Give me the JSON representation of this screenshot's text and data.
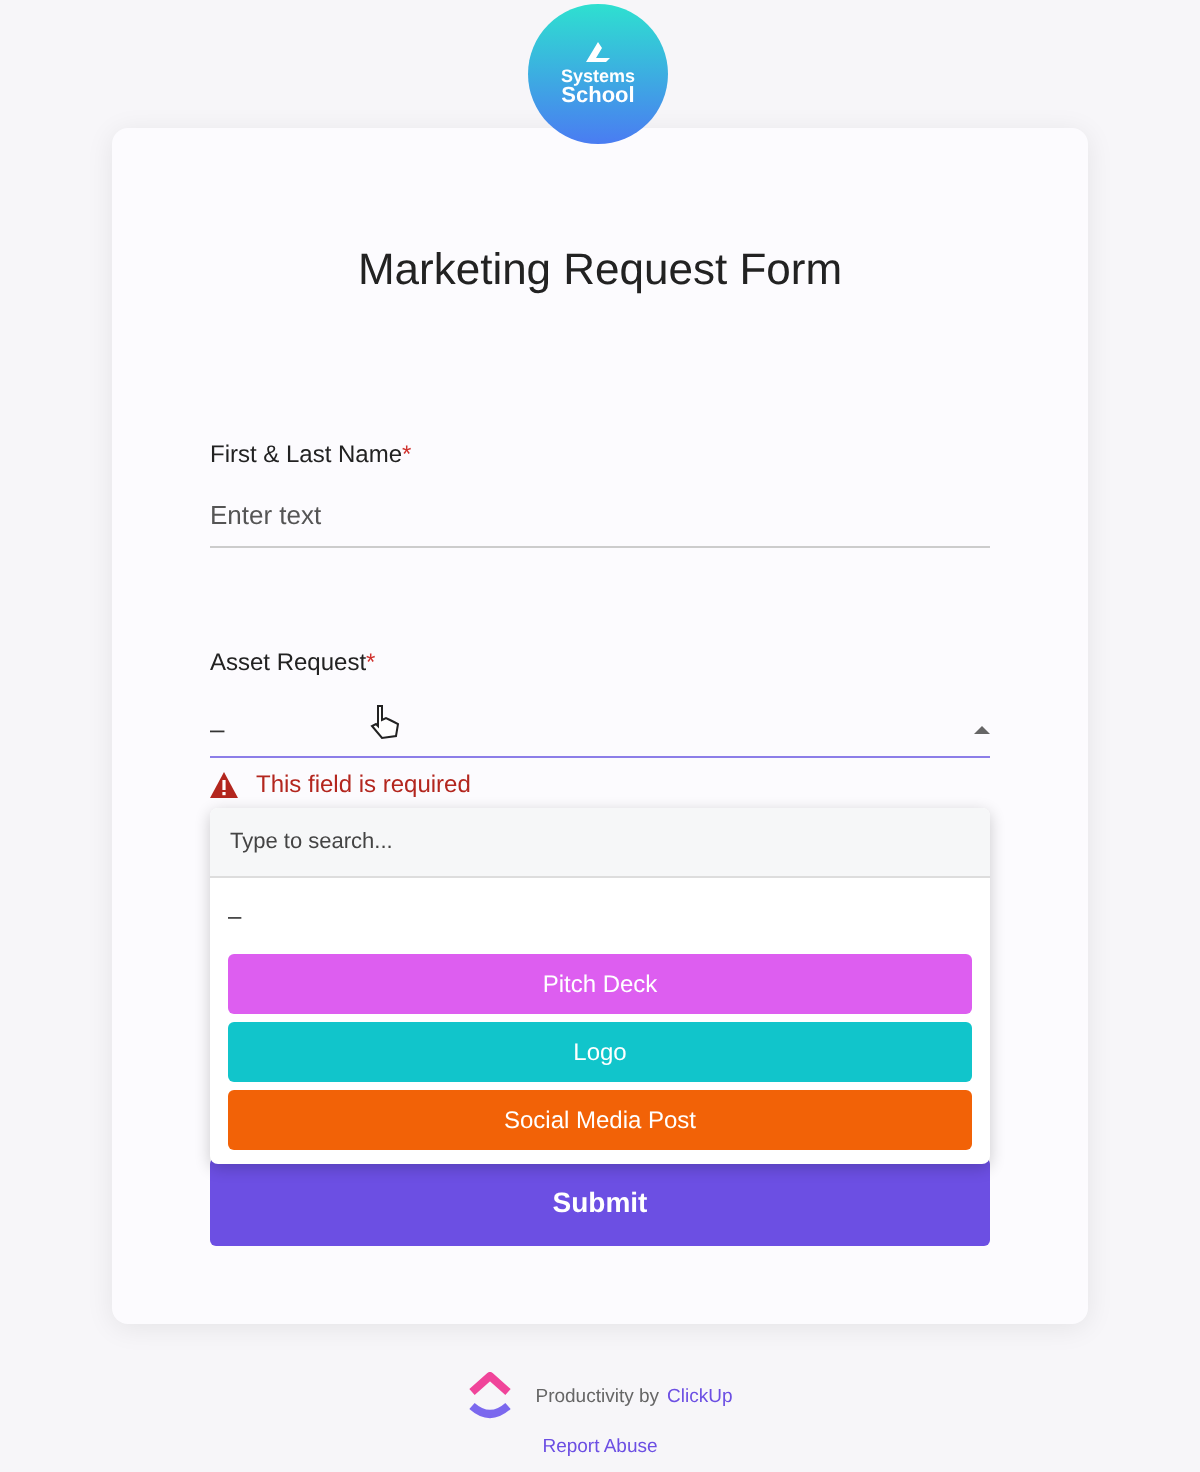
{
  "logo": {
    "line_1": "Systems",
    "line_2": "School"
  },
  "form": {
    "title": "Marketing Request Form",
    "fields": [
      {
        "kind": "text",
        "label": "First & Last Name",
        "required_mark": "*",
        "placeholder": "Enter text"
      },
      {
        "kind": "select",
        "label": "Asset Request",
        "required_mark": "*",
        "value": "–",
        "expanded": true,
        "error": "This field is required"
      }
    ],
    "dropdown": {
      "search_placeholder": "Type to search...",
      "empty_option": "–",
      "options": [
        {
          "label": "Pitch Deck",
          "color": "#dd5ef0"
        },
        {
          "label": "Logo",
          "color": "#11c5cb"
        },
        {
          "label": "Social Media Post",
          "color": "#f26207"
        }
      ]
    },
    "submit": "Submit"
  },
  "footer": {
    "prefix": "Productivity by",
    "brand": "ClickUp",
    "report": "Report Abuse"
  }
}
